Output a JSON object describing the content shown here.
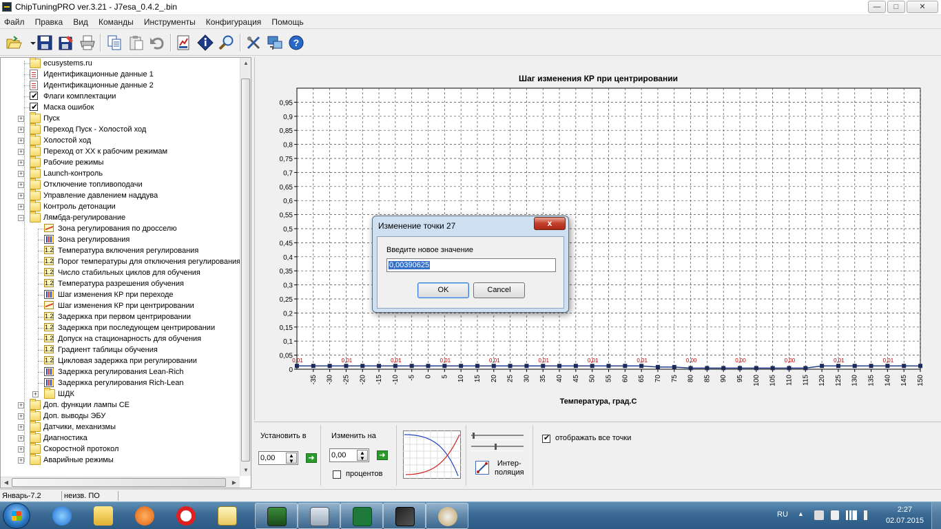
{
  "window": {
    "title": "ChipTuningPRO ver.3.21 - J7esa_0.4.2_.bin",
    "minimize": "—",
    "maximize": "□",
    "close": "✕"
  },
  "menu": [
    "Файл",
    "Правка",
    "Вид",
    "Команды",
    "Инструменты",
    "Конфигурация",
    "Помощь"
  ],
  "toolbar": [
    {
      "name": "open-icon"
    },
    {
      "name": "dropdown-arrow-icon"
    },
    {
      "name": "save-icon"
    },
    {
      "name": "save-as-icon"
    },
    {
      "name": "print-icon"
    },
    {
      "name": "copy-icon"
    },
    {
      "name": "paste-icon"
    },
    {
      "name": "undo-icon"
    },
    {
      "name": "compare-icon"
    },
    {
      "name": "info-icon"
    },
    {
      "name": "search-icon"
    },
    {
      "name": "tools-icon"
    },
    {
      "name": "connect-icon"
    },
    {
      "name": "help-icon"
    }
  ],
  "tree": [
    {
      "label": "ecusystems.ru",
      "icon": "folder",
      "level": 1,
      "expander": ""
    },
    {
      "label": "Идентификационные данные 1",
      "icon": "doc",
      "level": 1,
      "expander": ""
    },
    {
      "label": "Идентификационные данные 2",
      "icon": "doc",
      "level": 1,
      "expander": ""
    },
    {
      "label": "Флаги комплектации",
      "icon": "check",
      "level": 1,
      "expander": ""
    },
    {
      "label": "Маска ошибок",
      "icon": "check",
      "level": 1,
      "expander": ""
    },
    {
      "label": "Пуск",
      "icon": "folder",
      "level": 1,
      "expander": "+"
    },
    {
      "label": "Переход Пуск - Холостой ход",
      "icon": "folder",
      "level": 1,
      "expander": "+"
    },
    {
      "label": "Холостой ход",
      "icon": "folder",
      "level": 1,
      "expander": "+"
    },
    {
      "label": "Переход от ХХ к рабочим режимам",
      "icon": "folder",
      "level": 1,
      "expander": "+"
    },
    {
      "label": "Рабочие режимы",
      "icon": "folder",
      "level": 1,
      "expander": "+"
    },
    {
      "label": "Launch-контроль",
      "icon": "folder",
      "level": 1,
      "expander": "+"
    },
    {
      "label": "Отключение топливоподачи",
      "icon": "folder",
      "level": 1,
      "expander": "+"
    },
    {
      "label": "Управление давлением наддува",
      "icon": "folder",
      "level": 1,
      "expander": "+"
    },
    {
      "label": "Контроль детонации",
      "icon": "folder",
      "level": 1,
      "expander": "+"
    },
    {
      "label": "Лямбда-регулирование",
      "icon": "folder",
      "level": 1,
      "expander": "-"
    },
    {
      "label": "Зона регулирования по дросселю",
      "icon": "graphic",
      "level": 2,
      "expander": ""
    },
    {
      "label": "Зона регулирования",
      "icon": "bar3",
      "level": 2,
      "expander": ""
    },
    {
      "label": "Температура включения регулирования",
      "icon": "num12",
      "level": 2,
      "expander": ""
    },
    {
      "label": "Порог температуры для отключения регулирования",
      "icon": "num12",
      "level": 2,
      "expander": ""
    },
    {
      "label": "Число стабильных циклов для обучения",
      "icon": "num12",
      "level": 2,
      "expander": ""
    },
    {
      "label": "Температура разрешения обучения",
      "icon": "num12",
      "level": 2,
      "expander": ""
    },
    {
      "label": "Шаг изменения КР при переходе",
      "icon": "bar3",
      "level": 2,
      "expander": ""
    },
    {
      "label": "Шаг изменения КР при центрировании",
      "icon": "graphic",
      "level": 2,
      "expander": ""
    },
    {
      "label": "Задержка при первом центрировании",
      "icon": "num12",
      "level": 2,
      "expander": ""
    },
    {
      "label": "Задержка при последующем центрировании",
      "icon": "num12",
      "level": 2,
      "expander": ""
    },
    {
      "label": "Допуск на стационарность для обучения",
      "icon": "num12",
      "level": 2,
      "expander": ""
    },
    {
      "label": "Градиент таблицы обучения",
      "icon": "num12",
      "level": 2,
      "expander": ""
    },
    {
      "label": "Цикловая задержка при регулировании",
      "icon": "num12",
      "level": 2,
      "expander": ""
    },
    {
      "label": "Задержка регулирования Lean-Rich",
      "icon": "bar3",
      "level": 2,
      "expander": ""
    },
    {
      "label": "Задержка регулирования Rich-Lean",
      "icon": "bar3",
      "level": 2,
      "expander": ""
    },
    {
      "label": "ШДК",
      "icon": "folder",
      "level": 2,
      "expander": "+"
    },
    {
      "label": "Доп. функции лампы CE",
      "icon": "folder",
      "level": 1,
      "expander": "+"
    },
    {
      "label": "Доп. выводы ЭБУ",
      "icon": "folder",
      "level": 1,
      "expander": "+"
    },
    {
      "label": "Датчики, механизмы",
      "icon": "folder",
      "level": 1,
      "expander": "+"
    },
    {
      "label": "Диагностика",
      "icon": "folder",
      "level": 1,
      "expander": "+"
    },
    {
      "label": "Скоростной протокол",
      "icon": "folder",
      "level": 1,
      "expander": "+"
    },
    {
      "label": "Аварийные режимы",
      "icon": "folder",
      "level": 1,
      "expander": "+"
    }
  ],
  "chart_data": {
    "type": "line",
    "title": "Шаг изменения КР при центрировании",
    "xlabel": "Температура, град.C",
    "ylabel": "",
    "ylim": [
      0,
      1
    ],
    "yticks": [
      "0",
      "0,05",
      "0,1",
      "0,15",
      "0,2",
      "0,25",
      "0,3",
      "0,35",
      "0,4",
      "0,45",
      "0,5",
      "0,55",
      "0,6",
      "0,65",
      "0,7",
      "0,75",
      "0,8",
      "0,85",
      "0,9",
      "0,95"
    ],
    "xticks": [
      "-35",
      "-30",
      "-25",
      "-20",
      "-15",
      "-10",
      "-5",
      "0",
      "5",
      "10",
      "15",
      "20",
      "25",
      "30",
      "35",
      "40",
      "45",
      "50",
      "55",
      "60",
      "65",
      "70",
      "75",
      "80",
      "85",
      "90",
      "95",
      "100",
      "105",
      "110",
      "115",
      "120",
      "125",
      "130",
      "135",
      "140",
      "145",
      "150"
    ],
    "x": [
      -40,
      -35,
      -30,
      -25,
      -20,
      -15,
      -10,
      -5,
      0,
      5,
      10,
      15,
      20,
      25,
      30,
      35,
      40,
      45,
      50,
      55,
      60,
      65,
      70,
      75,
      80,
      85,
      90,
      95,
      100,
      105,
      110,
      115,
      120,
      125,
      130,
      135,
      140,
      145,
      150
    ],
    "y": [
      0.0117,
      0.0117,
      0.0117,
      0.0117,
      0.0117,
      0.0117,
      0.0117,
      0.0117,
      0.0117,
      0.0117,
      0.0117,
      0.0117,
      0.0117,
      0.0117,
      0.0117,
      0.0117,
      0.0117,
      0.0117,
      0.0117,
      0.0117,
      0.0117,
      0.0117,
      0.0078,
      0.0078,
      0.0039,
      0.0039,
      0.0039,
      0.0039,
      0.0039,
      0.0039,
      0.0039,
      0.0039,
      0.0117,
      0.0117,
      0.0117,
      0.0117,
      0.0117,
      0.0117,
      0.0117
    ],
    "point_labels": [
      {
        "x": -40,
        "text": "0,01"
      },
      {
        "x": -25,
        "text": "0,01"
      },
      {
        "x": -10,
        "text": "0,01"
      },
      {
        "x": 5,
        "text": "0,01"
      },
      {
        "x": 20,
        "text": "0,01"
      },
      {
        "x": 35,
        "text": "0,01"
      },
      {
        "x": 50,
        "text": "0,01"
      },
      {
        "x": 65,
        "text": "0,01"
      },
      {
        "x": 80,
        "text": "0,00"
      },
      {
        "x": 95,
        "text": "0,00"
      },
      {
        "x": 110,
        "text": "0,00"
      },
      {
        "x": 125,
        "text": "0,01"
      },
      {
        "x": 140,
        "text": "0,01"
      }
    ],
    "grid": true,
    "line_color": "#1f3a8a",
    "label_color": "#c00000"
  },
  "bottom": {
    "set_label": "Установить в",
    "set_value": "0,00",
    "change_label": "Изменить на",
    "change_value": "0,00",
    "percent_label": "процентов",
    "interp_label_1": "Интер-",
    "interp_label_2": "поляция",
    "show_all_label": "отображать все точки"
  },
  "status": {
    "left": "Январь-7.2",
    "right": "неизв. ПО"
  },
  "dialog": {
    "title": "Изменение точки 27",
    "close": "x",
    "prompt": "Введите новое значение",
    "value": "0,00390625",
    "ok": "OK",
    "cancel": "Cancel"
  },
  "taskbar": {
    "items": [
      "internet-explorer-icon",
      "file-explorer-icon",
      "media-player-icon",
      "yandex-browser-icon",
      "notepad-icon",
      "terminal-icon",
      "calculator-icon",
      "excel-icon",
      "chiptuning-icon",
      "paint-icon"
    ],
    "lang": "RU",
    "time": "2:27",
    "date": "02.07.2015"
  }
}
